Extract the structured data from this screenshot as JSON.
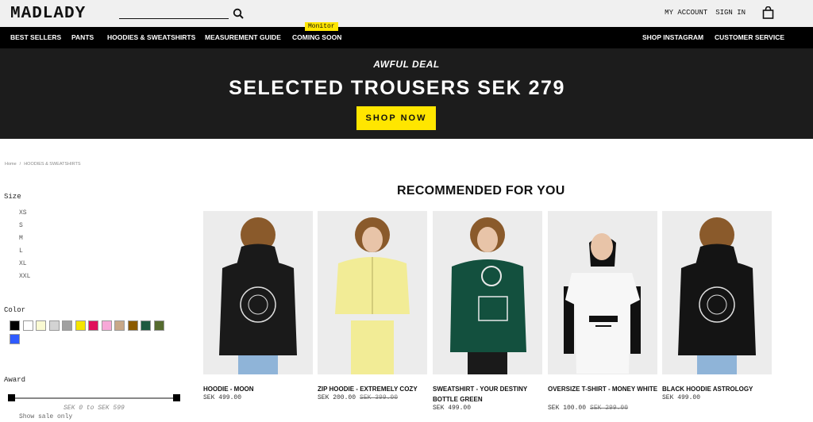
{
  "header": {
    "logo": "MADLADY",
    "my_account": "MY ACCOUNT",
    "sign_in": "SIGN IN"
  },
  "nav": {
    "left": [
      "BEST SELLERS",
      "PANTS",
      "HOODIES & SWEATSHIRTS",
      "MEASUREMENT GUIDE",
      "COMING SOON"
    ],
    "right": [
      "SHOP INSTAGRAM",
      "CUSTOMER SERVICE"
    ],
    "badge": "Monitor"
  },
  "hero": {
    "pre": "AWFUL DEAL",
    "title": "SELECTED TROUSERS SEK 279",
    "button": "SHOP NOW"
  },
  "breadcrumb": [
    "Home",
    "/",
    "HOODIES & SWEATSHIRTS"
  ],
  "filters": {
    "size_title": "Size",
    "sizes": [
      "XS",
      "S",
      "M",
      "L",
      "XL",
      "XXL"
    ],
    "color_title": "Color",
    "colors": [
      "#000000",
      "#ffffff",
      "#fafad2",
      "#d3d3d3",
      "#a0a0a0",
      "#f5e500",
      "#e0105a",
      "#f7a8d8",
      "#c8a888",
      "#8b5a00",
      "#1f5a40",
      "#556b2f",
      "#2f5bff"
    ],
    "award_title": "Award",
    "price_range": "SEK 0 to SEK 599",
    "sale_only": "Show sale only"
  },
  "recommended": {
    "title": "RECOMMENDED FOR YOU",
    "products": [
      {
        "name": "HOODIE - MOON",
        "price": "SEK 499.00",
        "old_price": "",
        "garment": "#1a1a1a",
        "garment_print": "#dddddd",
        "pants": "#8fb4d8"
      },
      {
        "name": "ZIP HOODIE - EXTREMELY COZY",
        "price": "SEK 200.00",
        "old_price": "SEK 399.00",
        "garment": "#f2ec96",
        "garment_print": "#f2ec96",
        "pants": "#f2ec96"
      },
      {
        "name": "SWEATSHIRT - YOUR DESTINY BOTTLE GREEN",
        "price": "SEK 499.00",
        "old_price": "",
        "garment": "#13503e",
        "garment_print": "#e8e8e8",
        "pants": "#1a1a1a"
      },
      {
        "name": "OVERSIZE T-SHIRT - MONEY WHITE",
        "price": "SEK 100.00",
        "old_price": "SEK 299.00",
        "garment": "#f7f7f7",
        "garment_print": "#111111",
        "pants": "#111111"
      },
      {
        "name": "BLACK HOODIE ASTROLOGY",
        "price": "SEK 499.00",
        "old_price": "",
        "garment": "#141414",
        "garment_print": "#dddddd",
        "pants": "#8fb4d8"
      }
    ]
  }
}
